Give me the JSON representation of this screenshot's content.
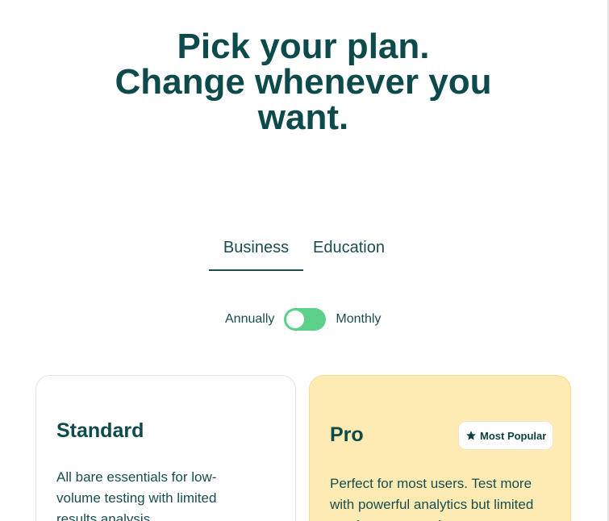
{
  "hero": {
    "line1": "Pick your plan.",
    "line2": "Change whenever you",
    "line3": "want."
  },
  "tabs": [
    {
      "label": "Business",
      "active": true
    },
    {
      "label": "Education",
      "active": false
    }
  ],
  "billing": {
    "left_label": "Annually",
    "right_label": "Monthly",
    "toggle_color": "#5cd08a"
  },
  "plans": [
    {
      "name": "Standard",
      "description": "All bare essentials for low-volume testing with limited results analysis."
    },
    {
      "name": "Pro",
      "badge": "Most Popular",
      "badge_icon": "star-icon",
      "description": "Perfect for most users. Test more with powerful analytics but limited results segmentation."
    }
  ],
  "colors": {
    "heading": "#0c4a4b",
    "text": "#1a4d50",
    "pro_card_bg": "#fdebb3"
  }
}
